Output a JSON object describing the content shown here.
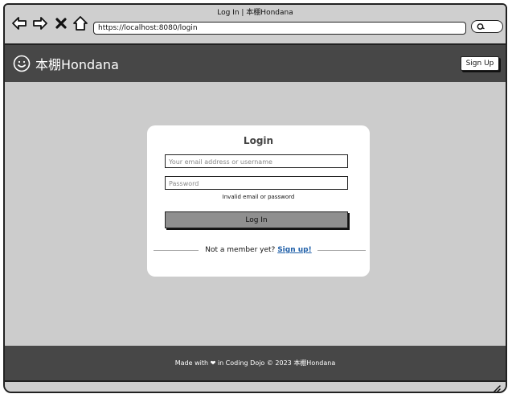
{
  "browser": {
    "window_title": "Log In | 本棚Hondana",
    "url": "https://localhost:8080/login"
  },
  "header": {
    "brand": "本棚Hondana",
    "signup_label": "Sign Up"
  },
  "login": {
    "title": "Login",
    "email_placeholder": "Your email address or username",
    "password_placeholder": "Password",
    "error": "Invalid email or password",
    "submit_label": "Log In",
    "member_prompt": "Not a member yet?",
    "signup_link": "Sign up!"
  },
  "footer": {
    "text": "Made with ❤ in Coding Dojo © 2023 本棚Hondana"
  },
  "icons": {
    "back": "arrow-left-icon",
    "forward": "arrow-right-icon",
    "stop": "close-icon",
    "home": "home-icon",
    "search": "search-icon",
    "logo": "smiley-icon",
    "resize": "resize-grip-icon"
  }
}
